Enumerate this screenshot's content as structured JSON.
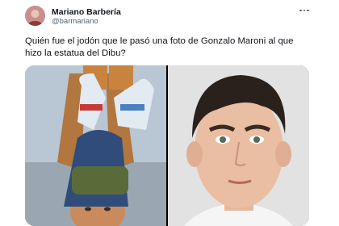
{
  "tweet": {
    "author_name": "Mariano Barbería",
    "author_handle": "@barmariano",
    "text": "Quién fue el jodón que le pasó una foto de Gonzalo Maroni al que hizo la estatua del Dibu?",
    "avatar_icon": "user-avatar",
    "more_icon": "more-horizontal-icon",
    "media": {
      "left_image": "statue-photo",
      "right_image": "player-portrait-photo"
    }
  }
}
